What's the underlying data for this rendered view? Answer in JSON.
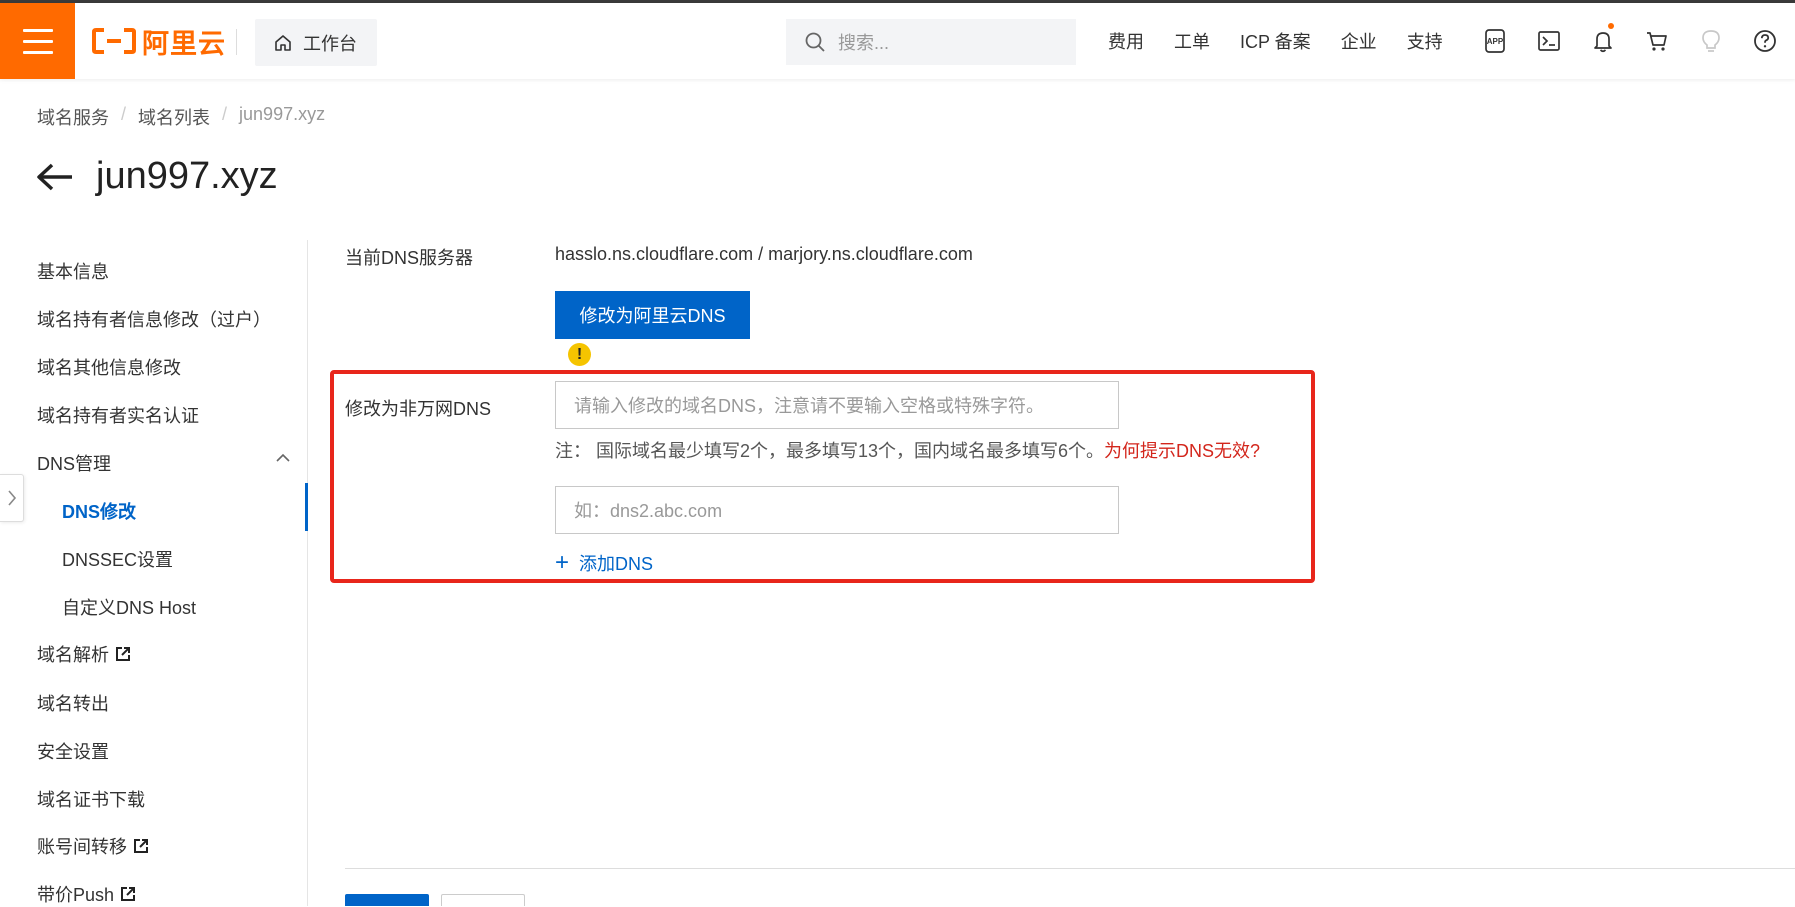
{
  "header": {
    "logo_text": "阿里云",
    "workbench_label": "工作台",
    "search_placeholder": "搜索...",
    "nav": [
      "费用",
      "工单",
      "ICP 备案",
      "企业",
      "支持"
    ],
    "brand_color": "#ff6a00"
  },
  "breadcrumb": [
    "域名服务",
    "域名列表",
    "jun997.xyz"
  ],
  "page_title": "jun997.xyz",
  "sidebar": {
    "items": [
      {
        "label": "基本信息"
      },
      {
        "label": "域名持有者信息修改（过户）"
      },
      {
        "label": "域名其他信息修改"
      },
      {
        "label": "域名持有者实名认证"
      },
      {
        "label": "DNS管理"
      },
      {
        "label": "DNS修改"
      },
      {
        "label": "DNSSEC设置"
      },
      {
        "label": "自定义DNS Host"
      },
      {
        "label": "域名解析"
      },
      {
        "label": "域名转出"
      },
      {
        "label": "安全设置"
      },
      {
        "label": "域名证书下载"
      },
      {
        "label": "账号间转移"
      },
      {
        "label": "带价Push"
      }
    ]
  },
  "form": {
    "current_dns_label": "当前DNS服务器",
    "current_dns_value": "hasslo.ns.cloudflare.com / marjory.ns.cloudflare.com",
    "switch_button": "修改为阿里云DNS",
    "custom_dns_label": "修改为非万网DNS",
    "dns_input1_placeholder": "请输入修改的域名DNS，注意请不要输入空格或特殊字符。",
    "note_text": "注：  国际域名最少填写2个，最多填写13个，国内域名最多填写6个。",
    "note_link": "为何提示DNS无效?",
    "dns_input2_placeholder": "如：dns2.abc.com",
    "add_dns": "添加DNS"
  },
  "colors": {
    "primary": "#0064c8",
    "highlight_box": "#e8261b",
    "warning": "#f5c400"
  }
}
